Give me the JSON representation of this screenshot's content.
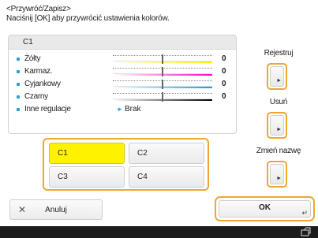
{
  "header": {
    "title": "<Przywróć/Zapisz>",
    "instruction": "Naciśnij [OK] aby przywrócić ustawienia kolorów."
  },
  "panel": {
    "heading": "C1",
    "rows": [
      {
        "label": "Żółty",
        "value": "0",
        "level": 0.5,
        "gradient": [
          "#ffffff",
          "#ffef00"
        ]
      },
      {
        "label": "Karmaz.",
        "value": "0",
        "level": 0.5,
        "gradient": [
          "#ffffff",
          "#ff00cc"
        ]
      },
      {
        "label": "Cyjankowy",
        "value": "0",
        "level": 0.5,
        "gradient": [
          "#ffffff",
          "#00a8e8"
        ]
      },
      {
        "label": "Czarny",
        "value": "0",
        "level": 0.5,
        "gradient": [
          "#ffffff",
          "#000000"
        ]
      }
    ],
    "other": {
      "label": "Inne regulacje",
      "value": "Brak"
    }
  },
  "presets": [
    {
      "label": "C1",
      "selected": true
    },
    {
      "label": "C2",
      "selected": false
    },
    {
      "label": "C3",
      "selected": false
    },
    {
      "label": "C4",
      "selected": false
    }
  ],
  "side": {
    "register_label": "Rejestruj",
    "delete_label": "Usuń",
    "rename_label": "Zmień nazwę"
  },
  "buttons": {
    "cancel_label": "Anuluj",
    "ok_label": "OK"
  },
  "icons": {
    "cancel": "close-icon",
    "enter": "enter-icon",
    "status": "status-icon",
    "bullet": "bullet-icon",
    "arrow": "triangle-right-icon"
  },
  "colors": {
    "accent": "#f0a533",
    "selected": "#fff200",
    "bullet": "#2aa0cf",
    "statusbar": "#1c1c1c"
  }
}
